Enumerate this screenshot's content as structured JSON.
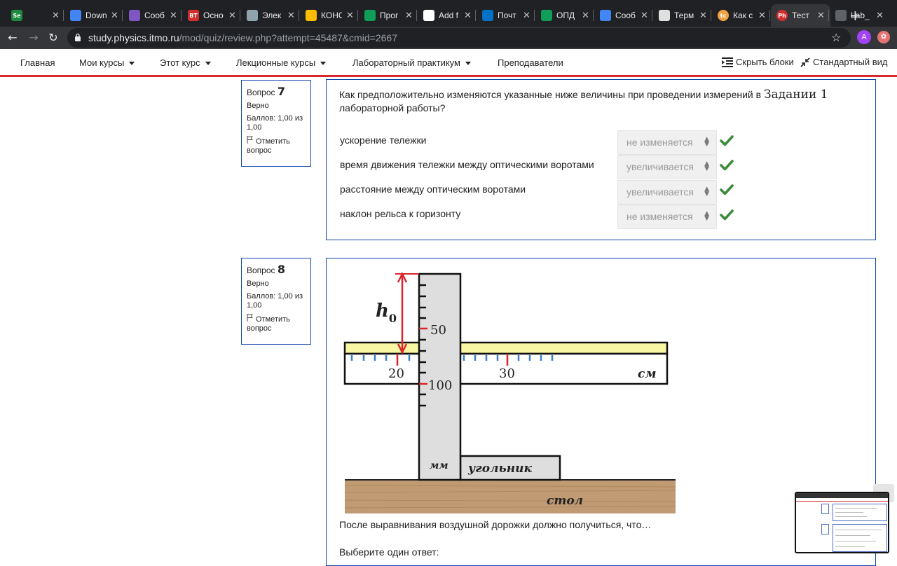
{
  "browser": {
    "tabs": [
      {
        "title": "",
        "icon": "sheets-se-icon",
        "color": "#1f8a3e",
        "glyph": "Se"
      },
      {
        "title": "Down",
        "icon": "docs-icon",
        "color": "#4285f4",
        "glyph": ""
      },
      {
        "title": "Сооб",
        "icon": "message-flag-icon",
        "color": "#7e57c2",
        "glyph": ""
      },
      {
        "title": "Осно",
        "icon": "vt-icon",
        "color": "#d32f2f",
        "glyph": "ВТ"
      },
      {
        "title": "Элек",
        "icon": "chart-icon",
        "color": "#90a4ae",
        "glyph": ""
      },
      {
        "title": "КОНС",
        "icon": "google-drive-icon",
        "color": "#fbbc04",
        "glyph": ""
      },
      {
        "title": "Прог",
        "icon": "sheets-icon",
        "color": "#0f9d58",
        "glyph": ""
      },
      {
        "title": "Add f",
        "icon": "github-icon",
        "color": "#ffffff",
        "glyph": ""
      },
      {
        "title": "Почт",
        "icon": "outlook-icon",
        "color": "#0072c6",
        "glyph": ""
      },
      {
        "title": "ОПД",
        "icon": "sheets-icon",
        "color": "#0f9d58",
        "glyph": ""
      },
      {
        "title": "Сооб",
        "icon": "chat-icon",
        "color": "#4285f4",
        "glyph": ""
      },
      {
        "title": "Терм",
        "icon": "penguin-icon",
        "color": "#e0e0e0",
        "glyph": ""
      },
      {
        "title": "Как с",
        "icon": "tc-icon",
        "color": "#f4a142",
        "glyph": "tc"
      },
      {
        "title": "Тест",
        "icon": "ph-icon",
        "color": "#d32f2f",
        "glyph": "Ph"
      },
      {
        "title": "Lab_",
        "icon": "globe-icon",
        "color": "#5f6368",
        "glyph": ""
      }
    ],
    "url_host": "study.physics.itmo.ru",
    "url_path": "/mod/quiz/review.php?attempt=45487&cmid=2667",
    "avatar_letter": "A"
  },
  "nav": {
    "items": [
      "Главная",
      "Мои курсы",
      "Этот курс",
      "Лекционные курсы",
      "Лабораторный практикум",
      "Преподаватели"
    ],
    "hide_blocks": "Скрыть блоки",
    "standard_view": "Стандартный вид"
  },
  "q7": {
    "label": "Вопрос",
    "number": "7",
    "state": "Верно",
    "grade": "Баллов: 1,00 из 1,00",
    "flag": "Отметить вопрос",
    "text_before": "Как предположительно изменяются указанные ниже величины при проведении измерений в ",
    "text_math": "Задании 1",
    "text_after": " лабораторной работы?",
    "rows": [
      {
        "label": "ускорение тележки",
        "answer": "не изменяется"
      },
      {
        "label": "время движения тележки между оптическими воротами",
        "answer": "увеличивается"
      },
      {
        "label": "расстояние между оптическим воротами",
        "answer": "увеличивается"
      },
      {
        "label": "наклон рельса к горизонту",
        "answer": "не изменяется"
      }
    ]
  },
  "q8": {
    "label": "Вопрос",
    "number": "8",
    "state": "Верно",
    "grade": "Баллов: 1,00 из 1,00",
    "flag": "Отметить вопрос",
    "figure": {
      "h0_main": "h",
      "h0_sub": "0",
      "mark_50": "50",
      "mark_100": "100",
      "mark_20": "20",
      "mark_30": "30",
      "unit_cm": "см",
      "unit_mm": "мм",
      "square_label": "угольник",
      "table_label": "стол"
    },
    "text": "После выравнивания воздушной дорожки должно получиться, что…",
    "choose": "Выберите один ответ:"
  },
  "colors": {
    "accent_red": "#d9262b",
    "border_blue": "#0f47ad",
    "check_green": "#3c8a3c"
  }
}
